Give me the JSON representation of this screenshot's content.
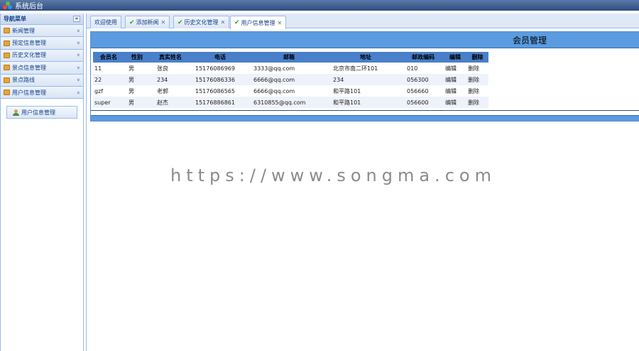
{
  "app": {
    "title": "系统后台"
  },
  "sidebar": {
    "header": "导航菜单",
    "collapse_icon": "«",
    "items": [
      {
        "label": "新闻管理",
        "chevron": "»"
      },
      {
        "label": "预定信息管理",
        "chevron": "»"
      },
      {
        "label": "历史文化管理",
        "chevron": "»"
      },
      {
        "label": "景点信息管理",
        "chevron": "»"
      },
      {
        "label": "景点路线",
        "chevron": "»"
      },
      {
        "label": "用户信息管理",
        "chevron": "«"
      }
    ],
    "submenu": [
      {
        "label": "用户信息管理"
      }
    ]
  },
  "tabs": [
    {
      "label": "欢迎使用",
      "closable": false
    },
    {
      "label": "添加新闻",
      "closable": true
    },
    {
      "label": "历史文化管理",
      "closable": true
    },
    {
      "label": "用户信息管理",
      "closable": true
    }
  ],
  "panel": {
    "title": "会员管理"
  },
  "table": {
    "columns": [
      "会员名",
      "性别",
      "真实姓名",
      "电话",
      "邮箱",
      "地址",
      "邮政编码",
      "编辑",
      "删除"
    ],
    "rows": [
      {
        "username": "11",
        "gender": "男",
        "realname": "张良",
        "phone": "15176086969",
        "email": "3333@qq.com",
        "address": "北京市南二环101",
        "zip": "010",
        "edit": "编辑",
        "delete": "删除"
      },
      {
        "username": "22",
        "gender": "男",
        "realname": "234",
        "phone": "15176086336",
        "email": "6666@qq.com",
        "address": "234",
        "zip": "056300",
        "edit": "编辑",
        "delete": "删除"
      },
      {
        "username": "gzf",
        "gender": "男",
        "realname": "老郭",
        "phone": "15176086565",
        "email": "6666@qq.com",
        "address": "和平路101",
        "zip": "056660",
        "edit": "编辑",
        "delete": "删除"
      },
      {
        "username": "super",
        "gender": "男",
        "realname": "赵杰",
        "phone": "15176886861",
        "email": "6310855@qq.com",
        "address": "和平路101",
        "zip": "056600",
        "edit": "编辑",
        "delete": "删除"
      }
    ]
  },
  "watermark": "https://www.songma.com",
  "colors": {
    "header_bar": "#2f4e80",
    "panel_bar": "#5b9be0",
    "table_head": "#4a7fc9"
  }
}
